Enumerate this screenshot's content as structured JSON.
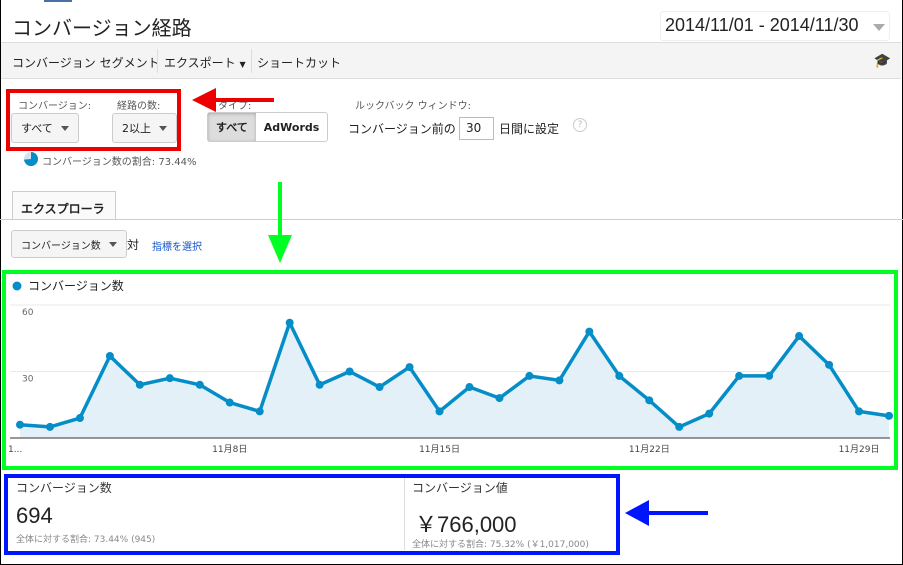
{
  "header": {
    "title": "コンバージョン経路",
    "date_range": "2014/11/01 - 2014/11/30"
  },
  "toolbar": {
    "items": [
      "コンバージョン セグメント",
      "エクスポート",
      "ショートカット"
    ]
  },
  "filters": {
    "conversion_label": "コンバージョン:",
    "conversion_value": "すべて",
    "path_count_label": "経路の数:",
    "path_count_value": "2以上",
    "type_label": "タイプ:",
    "type_options": [
      "すべて",
      "AdWords"
    ],
    "lookback_label": "ルックバック ウィンドウ:",
    "lookback_prefix": "コンバージョン前の",
    "lookback_days": "30",
    "lookback_suffix": "日間に設定",
    "help": "?"
  },
  "share": {
    "text": "コンバージョン数の割合: 73.44%",
    "fraction": 0.7344
  },
  "tabs": {
    "explorer": "エクスプローラ"
  },
  "metric": {
    "selected": "コンバージョン数",
    "vs": "対",
    "select_link": "指標を選択"
  },
  "chart_data": {
    "type": "area",
    "legend": "コンバージョン数",
    "color": "#058dc7",
    "x": [
      "11月1日",
      "11月2日",
      "11月3日",
      "11月4日",
      "11月5日",
      "11月6日",
      "11月7日",
      "11月8日",
      "11月9日",
      "11月10日",
      "11月11日",
      "11月12日",
      "11月13日",
      "11月14日",
      "11月15日",
      "11月16日",
      "11月17日",
      "11月18日",
      "11月19日",
      "11月20日",
      "11月21日",
      "11月22日",
      "11月23日",
      "11月24日",
      "11月25日",
      "11月26日",
      "11月27日",
      "11月28日",
      "11月29日",
      "11月30日"
    ],
    "values": [
      6,
      5,
      9,
      37,
      24,
      27,
      24,
      16,
      12,
      52,
      24,
      30,
      23,
      32,
      12,
      23,
      18,
      28,
      26,
      48,
      28,
      17,
      5,
      11,
      28,
      28,
      46,
      33,
      12,
      10
    ],
    "y_ticks": [
      "60",
      "30"
    ],
    "ylim": [
      0,
      60
    ],
    "x_ticks": [
      {
        "i": 0,
        "label": "1..."
      },
      {
        "i": 7,
        "label": "11月8日"
      },
      {
        "i": 14,
        "label": "11月15日"
      },
      {
        "i": 21,
        "label": "11月22日"
      },
      {
        "i": 28,
        "label": "11月29日"
      }
    ]
  },
  "kpis": [
    {
      "label": "コンバージョン数",
      "value": "694",
      "sub": "全体に対する割合: 73.44% (945)"
    },
    {
      "label": "コンバージョン値",
      "value": "￥766,000",
      "sub": "全体に対する割合: 75.32% (￥1,017,000)"
    }
  ],
  "colors": {
    "red": "#ee0000",
    "green": "#00ff22",
    "blue": "#0015ff"
  }
}
